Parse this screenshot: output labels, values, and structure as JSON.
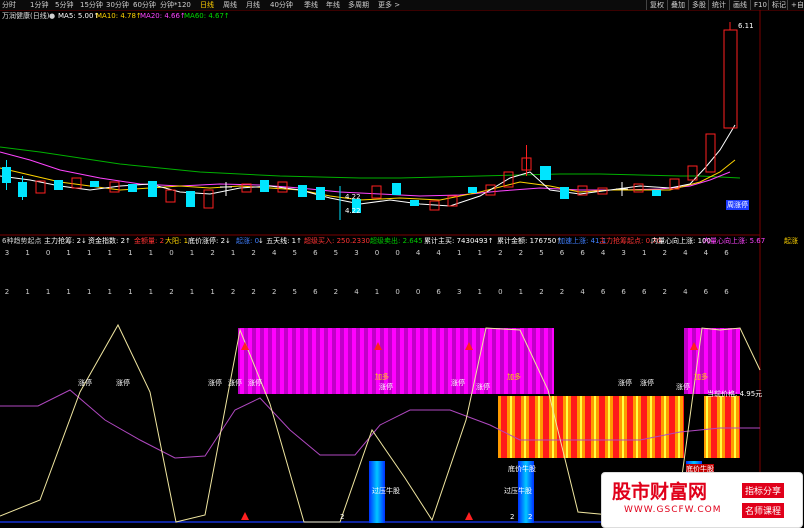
{
  "toolbar": {
    "tabs": [
      "分时",
      "1分钟",
      "5分钟",
      "15分钟",
      "30分钟",
      "60分钟",
      "分钟*120",
      "日线",
      "周线",
      "月线",
      "40分钟",
      "季线",
      "年线",
      "多周期",
      "更多 >"
    ],
    "right_buttons": [
      "复权",
      "叠加",
      "多股",
      "统计",
      "画线",
      "F10",
      "标记",
      "+自选",
      "返回"
    ]
  },
  "ma_bar": {
    "title": "万润健康(日线)",
    "ma5": "MA5: 5.00↑",
    "ma10": "MA10: 4.78↑",
    "ma20": "MA20: 4.66↑",
    "ma60": "MA60: 4.67↑",
    "colors": {
      "ma5": "#ffffff",
      "ma10": "#ffd400",
      "ma20": "#ff44ff",
      "ma60": "#00dd00"
    }
  },
  "kline": {
    "high_label": "6.11",
    "low_label": "4.22",
    "low_label_2": "4.22",
    "tag_label": "周涨停"
  },
  "indicator_bar": {
    "title": "6种趋势起点",
    "fields": [
      {
        "text": "主力抢筹: 2↓",
        "color": "#ffffff"
      },
      {
        "text": "资金指数: 2↑",
        "color": "#ffffff"
      },
      {
        "text": "金额量: 2",
        "color": "#ff3333"
      },
      {
        "text": "大阳: 1",
        "color": "#ffd400"
      },
      {
        "text": "底价涨停: 2↓",
        "color": "#ffffff"
      },
      {
        "text": "起涨: 0",
        "color": "#3f7fff"
      },
      {
        "text": "↓ 五天线: 1↑",
        "color": "#ffffff"
      },
      {
        "text": "超级买入: 250.2330",
        "color": "#ff3333"
      },
      {
        "text": "超级卖出: 2.645",
        "color": "#00cc00"
      },
      {
        "text": "累计主买: 7430493↑",
        "color": "#ffffff"
      },
      {
        "text": "累计金额: 176750↑",
        "color": "#ffffff"
      },
      {
        "text": "加速上涨: 41.1",
        "color": "#3f7fff"
      },
      {
        "text": "主力抢筹起点: 0.70",
        "color": "#ff3333"
      },
      {
        "text": "内量心向上涨: 100",
        "color": "#ffffff"
      },
      {
        "text": "内量心向上涨: 5.67",
        "color": "#ff44ff"
      },
      {
        "text": "起涨",
        "color": "#ffd400"
      }
    ]
  },
  "number_rows": {
    "row1": [
      "3",
      "1",
      "0",
      "1",
      "1",
      "1",
      "1",
      "1",
      "0",
      "1",
      "2",
      "1",
      "2",
      "4",
      "5",
      "6",
      "5",
      "3",
      "0",
      "0",
      "4",
      "4",
      "1",
      "1",
      "2",
      "2",
      "5",
      "6",
      "6",
      "4",
      "3",
      "1",
      "2",
      "4",
      "4",
      "6"
    ],
    "row2": [
      "2",
      "1",
      "1",
      "1",
      "1",
      "1",
      "1",
      "1",
      "2",
      "1",
      "1",
      "2",
      "2",
      "2",
      "5",
      "6",
      "2",
      "4",
      "1",
      "0",
      "0",
      "6",
      "3",
      "1",
      "0",
      "1",
      "2",
      "2",
      "4",
      "6",
      "6",
      "6",
      "2",
      "4",
      "6",
      "6"
    ]
  },
  "signals": {
    "labels": [
      {
        "text": "涨停",
        "color": "#ffffff"
      },
      {
        "text": "涨停",
        "color": "#ffffff"
      },
      {
        "text": "涨停",
        "color": "#ffffff"
      },
      {
        "text": "涨停",
        "color": "#ffffff"
      },
      {
        "text": "涨停",
        "color": "#ffffff"
      },
      {
        "text": "加多",
        "color": "#ffd400"
      },
      {
        "text": "涨停",
        "color": "#ffffff"
      },
      {
        "text": "涨停",
        "color": "#ffffff"
      },
      {
        "text": "加多",
        "color": "#ffd400"
      },
      {
        "text": "涨停",
        "color": "#ffffff"
      },
      {
        "text": "涨停",
        "color": "#ffffff"
      },
      {
        "text": "涨停",
        "color": "#ffffff"
      },
      {
        "text": "加多",
        "color": "#ffd400"
      },
      {
        "text": "涨停",
        "color": "#ffffff"
      }
    ],
    "price_tag": "当前价格: 4.95元",
    "bottom_labels": [
      "过压牛股",
      "过压牛股",
      "底价牛股",
      "底价牛股"
    ],
    "bottom_numbers": [
      "2",
      "2",
      "2"
    ]
  },
  "watermark": {
    "title": "股市财富网",
    "url": "WWW.GSCFW.COM",
    "tag1": "指标分享",
    "tag2": "名师课程"
  }
}
